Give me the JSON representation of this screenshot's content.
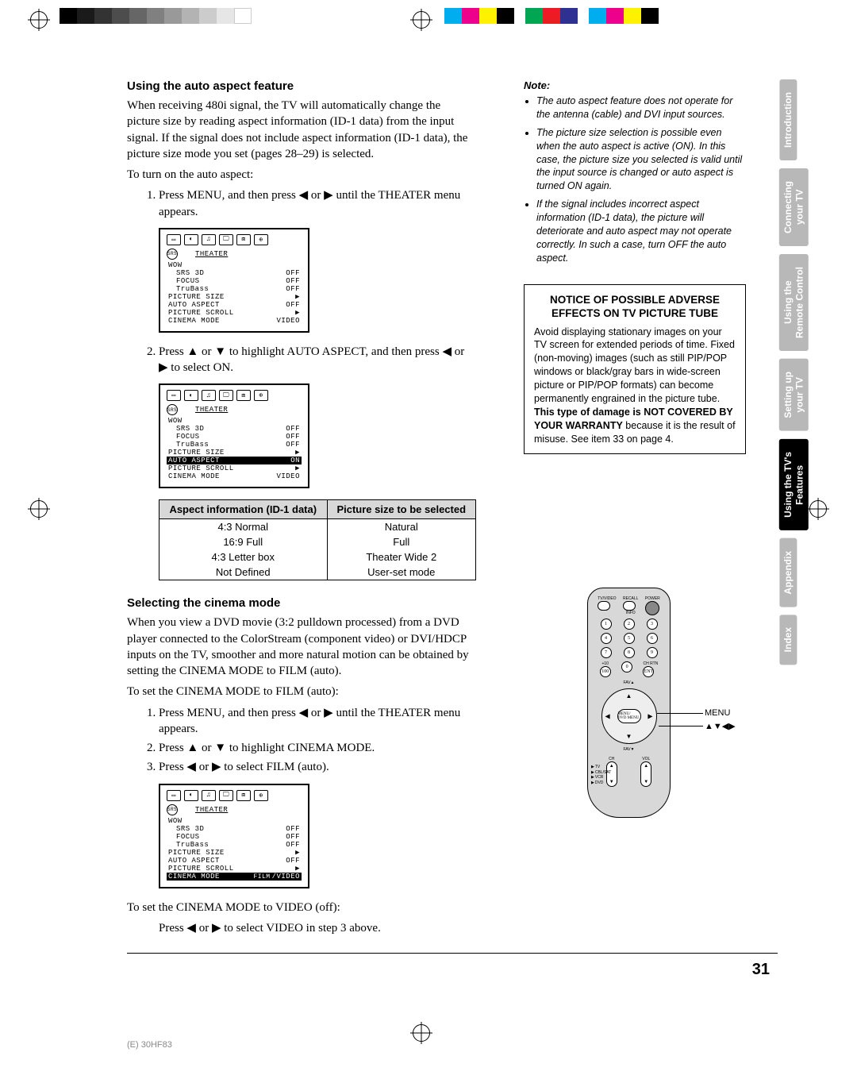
{
  "page_number": "31",
  "footer_code": "(E) 30HF83",
  "section1": {
    "heading": "Using the auto aspect feature",
    "para1": "When receiving 480i signal, the TV will automatically change the picture size by reading aspect information (ID-1 data) from the input signal. If the signal does not include aspect information (ID-1 data), the picture size mode you set (pages 28–29) is selected.",
    "para2": "To turn on the auto aspect:",
    "step1": "Press MENU, and then press ◀ or ▶ until the THEATER menu appears.",
    "step2": "Press ▲ or ▼ to highlight AUTO ASPECT, and then press ◀ or ▶ to select ON."
  },
  "osd": {
    "title": "THEATER",
    "rows": [
      {
        "label": "WOW",
        "value": "",
        "indent": 0
      },
      {
        "label": "SRS 3D",
        "value": "OFF",
        "indent": 1
      },
      {
        "label": "FOCUS",
        "value": "OFF",
        "indent": 1
      },
      {
        "label": "TruBass",
        "value": "OFF",
        "indent": 1
      },
      {
        "label": "PICTURE SIZE",
        "value": "▶",
        "indent": 0
      },
      {
        "label": "AUTO ASPECT",
        "value": "OFF",
        "indent": 0
      },
      {
        "label": "PICTURE SCROLL",
        "value": "▶",
        "indent": 0
      },
      {
        "label": "CINEMA MODE",
        "value": "VIDEO",
        "indent": 0
      }
    ]
  },
  "osd2": {
    "title": "THEATER",
    "rows": [
      {
        "label": "WOW",
        "value": "",
        "indent": 0
      },
      {
        "label": "SRS 3D",
        "value": "OFF",
        "indent": 1
      },
      {
        "label": "FOCUS",
        "value": "OFF",
        "indent": 1
      },
      {
        "label": "TruBass",
        "value": "OFF",
        "indent": 1
      },
      {
        "label": "PICTURE SIZE",
        "value": "▶",
        "indent": 0
      },
      {
        "label": "AUTO ASPECT",
        "value": "ON",
        "indent": 0,
        "hl": true
      },
      {
        "label": "PICTURE SCROLL",
        "value": "▶",
        "indent": 0
      },
      {
        "label": "CINEMA MODE",
        "value": "VIDEO",
        "indent": 0
      }
    ]
  },
  "id1_table": {
    "head1": "Aspect information (ID-1 data)",
    "head2": "Picture size to be selected",
    "rows": [
      {
        "a": "4:3 Normal",
        "b": "Natural"
      },
      {
        "a": "16:9 Full",
        "b": "Full"
      },
      {
        "a": "4:3 Letter box",
        "b": "Theater Wide 2"
      },
      {
        "a": "Not Defined",
        "b": "User-set mode"
      }
    ]
  },
  "section2": {
    "heading": "Selecting the cinema mode",
    "para1": "When you view a DVD movie (3:2 pulldown processed) from a DVD player connected to the ColorStream (component video) or DVI/HDCP inputs on the TV, smoother and more natural motion can be obtained by setting the CINEMA MODE to FILM (auto).",
    "para2": "To set the CINEMA MODE to FILM (auto):",
    "step1": "Press MENU, and then press ◀ or ▶ until the THEATER menu appears.",
    "step2": "Press ▲ or ▼ to highlight CINEMA MODE.",
    "step3": "Press ◀ or ▶ to select FILM (auto).",
    "para3": "To set the CINEMA MODE to VIDEO (off):",
    "para4": "Press ◀ or ▶ to select VIDEO in step 3 above."
  },
  "osd3": {
    "title": "THEATER",
    "rows": [
      {
        "label": "WOW",
        "value": "",
        "indent": 0
      },
      {
        "label": "SRS 3D",
        "value": "OFF",
        "indent": 1
      },
      {
        "label": "FOCUS",
        "value": "OFF",
        "indent": 1
      },
      {
        "label": "TruBass",
        "value": "OFF",
        "indent": 1
      },
      {
        "label": "PICTURE SIZE",
        "value": "▶",
        "indent": 0
      },
      {
        "label": "AUTO ASPECT",
        "value": "OFF",
        "indent": 0
      },
      {
        "label": "PICTURE SCROLL",
        "value": "▶",
        "indent": 0
      },
      {
        "label": "CINEMA MODE",
        "value": "FILM/VIDEO",
        "indent": 0,
        "hl": true,
        "sel": "FILM"
      }
    ]
  },
  "note": {
    "head": "Note:",
    "items": [
      "The auto aspect feature does not operate for the antenna (cable) and DVI input sources.",
      "The picture size selection is possible even when the auto aspect is active (ON). In this case, the picture size you selected is valid until the input source is changed or auto aspect is turned ON again.",
      "If the signal includes incorrect aspect information (ID-1 data), the picture will deteriorate and auto aspect may not operate correctly. In such a case, turn OFF the auto aspect."
    ]
  },
  "notice": {
    "title": "NOTICE OF POSSIBLE ADVERSE EFFECTS ON TV PICTURE TUBE",
    "body_pre": "Avoid displaying stationary images on your TV screen for extended periods of time. Fixed (non-moving) images (such as still PIP/POP windows or black/gray bars in wide-screen picture or PIP/POP formats) can become permanently engrained in the picture tube. ",
    "body_bold": "This type of damage is NOT COVERED BY YOUR WARRANTY",
    "body_post": " because it is the result of misuse. See item 33 on page 4."
  },
  "remote": {
    "label_menu": "MENU",
    "label_arrows": "▲▼◀▶",
    "top": {
      "tvvideo": "TV/VIDEO",
      "recall": "RECALL",
      "power": "POWER",
      "info": "INFO"
    },
    "nums": [
      "1",
      "2",
      "3",
      "4",
      "5",
      "6",
      "7",
      "8",
      "9",
      "0"
    ],
    "plus10": "+10",
    "chrtn": "CH RTN",
    "ent": "ENT",
    "hundred": "100",
    "fav_up": "FAV▲",
    "fav_dn": "FAV▼",
    "dpad_center": "MENU/\nDVD MENU",
    "ch": "CH",
    "vol": "VOL",
    "modes": [
      "TV",
      "CBL/SAT",
      "VCR",
      "DVD"
    ]
  },
  "tabs": [
    {
      "line1": "Introduction",
      "line2": "",
      "active": false
    },
    {
      "line1": "Connecting",
      "line2": "your TV",
      "active": false
    },
    {
      "line1": "Using the",
      "line2": "Remote Control",
      "active": false
    },
    {
      "line1": "Setting up",
      "line2": "your TV",
      "active": false
    },
    {
      "line1": "Using the TV's",
      "line2": "Features",
      "active": true
    },
    {
      "line1": "Appendix",
      "line2": "",
      "active": false
    },
    {
      "line1": "Index",
      "line2": "",
      "active": false
    }
  ]
}
